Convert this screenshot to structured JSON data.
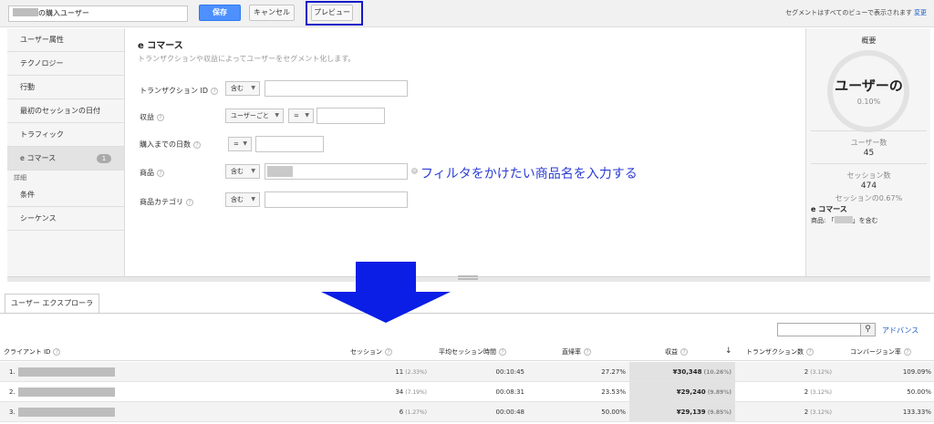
{
  "topbar": {
    "segment_name": "の購入ユーザー",
    "save_label": "保存",
    "cancel_label": "キャンセル",
    "preview_label": "プレビュー",
    "note": "セグメントはすべてのビューで表示されます",
    "change_link": "変更"
  },
  "leftnav": {
    "items": [
      "ユーザー属性",
      "テクノロジー",
      "行動",
      "最初のセッションの日付",
      "トラフィック",
      "e コマース"
    ],
    "ecommerce_badge": "1",
    "advanced_heading": "詳細",
    "advanced_items": [
      "条件",
      "シーケンス"
    ]
  },
  "form": {
    "title": "e コマース",
    "subtitle": "トランザクションや収益によってユーザーをセグメント化します。",
    "rows": [
      {
        "label": "トランザクション ID",
        "op": "含む"
      },
      {
        "label": "収益",
        "op": "ユーザーごと",
        "op2": "="
      },
      {
        "label": "購入までの日数",
        "op": "="
      },
      {
        "label": "商品",
        "op": "含む"
      },
      {
        "label": "商品カテゴリ",
        "op": "含む"
      }
    ],
    "annotation": "フィルタをかけたい商品名を入力する"
  },
  "summary": {
    "title": "概要",
    "big": "ユーザーの",
    "pct": "0.10%",
    "users_label": "ユーザー数",
    "users_value": "45",
    "sessions_label": "セッション数",
    "sessions_value": "474",
    "sessions_share": "セッションの0.67%",
    "section": "e コマース",
    "condition_prefix": "商品: 「",
    "condition_suffix": "」を含む"
  },
  "explorer": {
    "tab_label": "ユーザー エクスプローラ",
    "search_placeholder": "",
    "advanced_link": "アドバンス",
    "headers": {
      "client": "クライアント ID",
      "sessions": "セッション",
      "avg_duration": "平均セッション時間",
      "bounce": "直帰率",
      "revenue": "収益",
      "transactions": "トランザクション数",
      "conversion": "コンバージョン率"
    },
    "rows": [
      {
        "index": "1.",
        "sessions": "11",
        "sessions_pct": "(2.33%)",
        "duration": "00:10:45",
        "bounce": "27.27%",
        "revenue": "¥30,348",
        "revenue_pct": "(10.26%)",
        "transactions": "2",
        "transactions_pct": "(3.12%)",
        "conversion": "109.09%"
      },
      {
        "index": "2.",
        "sessions": "34",
        "sessions_pct": "(7.19%)",
        "duration": "00:08:31",
        "bounce": "23.53%",
        "revenue": "¥29,240",
        "revenue_pct": "(9.89%)",
        "transactions": "2",
        "transactions_pct": "(3.12%)",
        "conversion": "50.00%"
      },
      {
        "index": "3.",
        "sessions": "6",
        "sessions_pct": "(1.27%)",
        "duration": "00:00:48",
        "bounce": "50.00%",
        "revenue": "¥29,139",
        "revenue_pct": "(9.85%)",
        "transactions": "2",
        "transactions_pct": "(3.12%)",
        "conversion": "133.33%"
      }
    ]
  },
  "colors": {
    "primary_button": "#4d90fe",
    "highlight_box": "#1418c8",
    "annotation_arrow": "#0a1ee6",
    "link": "#1a5bc8"
  }
}
